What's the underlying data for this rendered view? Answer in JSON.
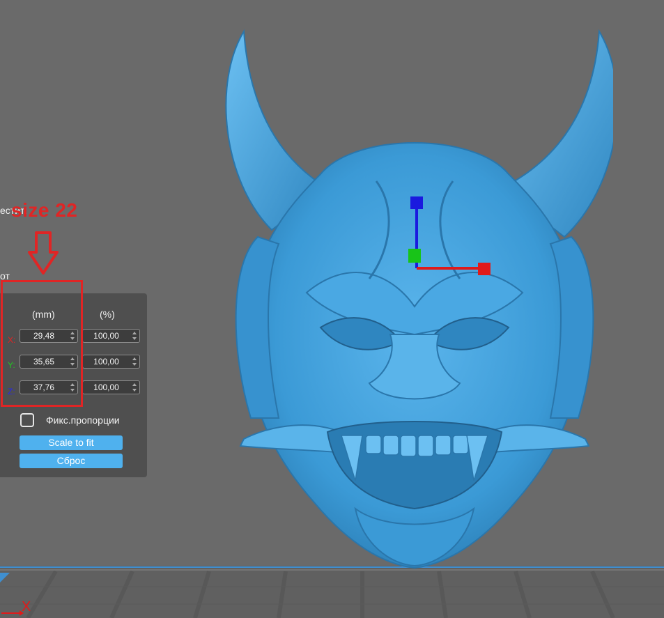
{
  "sidebar_fragments": {
    "line1": "естит:",
    "line2": "от"
  },
  "annotation": {
    "text": "size 22"
  },
  "scale_panel": {
    "col_mm": "(mm)",
    "col_pct": "(%)",
    "rows": [
      {
        "axis": "X:",
        "axis_color": "#e02424",
        "mm": "29,48",
        "pct": "100,00"
      },
      {
        "axis": "Y:",
        "axis_color": "#22c522",
        "mm": "35,65",
        "pct": "100,00"
      },
      {
        "axis": "Z:",
        "axis_color": "#2a2adf",
        "mm": "37,76",
        "pct": "100,00"
      }
    ],
    "lock_proportions_label": "Фикс.пропорции",
    "lock_proportions_checked": false,
    "scale_to_fit_label": "Scale to fit",
    "reset_label": "Сброс"
  },
  "corner_axis_label": "X",
  "colors": {
    "model": "#3b9ad6",
    "accent_button": "#4fb1ee",
    "annotation": "#e02525"
  }
}
